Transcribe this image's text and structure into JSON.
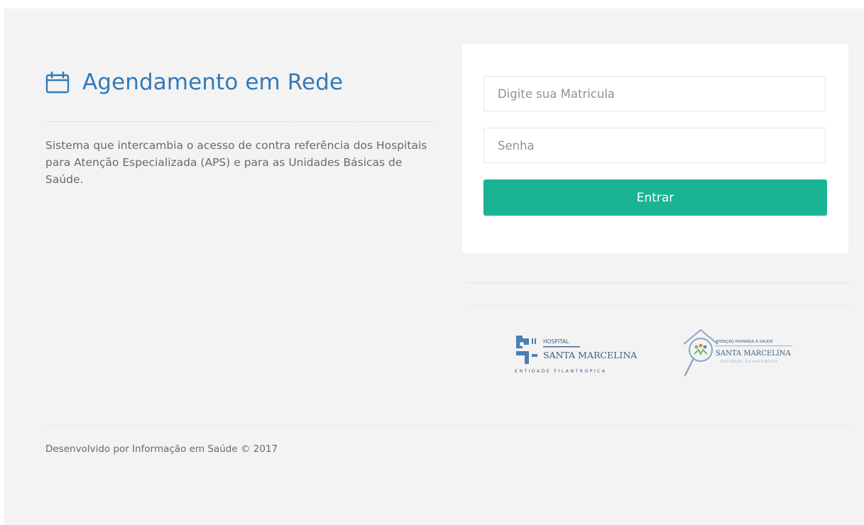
{
  "header": {
    "title": "Agendamento em Rede"
  },
  "description": "Sistema que intercambia o acesso de contra referência dos Hospitais para Atenção Especializada (APS) e para as Unidades Básicas de Saúde.",
  "login": {
    "matricula_placeholder": "Digite sua Matricula",
    "senha_placeholder": "Senha",
    "submit_label": "Entrar"
  },
  "logos": {
    "hospital": {
      "line1": "HOSPITAL",
      "line2": "SANTA MARCELINA",
      "line3": "ENTIDADE FILANTROPICA"
    },
    "aps": {
      "line1": "ATENÇÃO PRIMÁRIA À SAÚDE",
      "line2": "SANTA MARCELINA",
      "line3": "ENTIDADE FILANTRÓPICA"
    }
  },
  "footer": {
    "text": "Desenvolvido por Informação em Saúde © 2017"
  },
  "colors": {
    "title": "#337ab7",
    "button": "#1ab394",
    "background": "#f3f3f4",
    "text": "#676a6c"
  },
  "icons": {
    "header": "calendar-icon"
  }
}
